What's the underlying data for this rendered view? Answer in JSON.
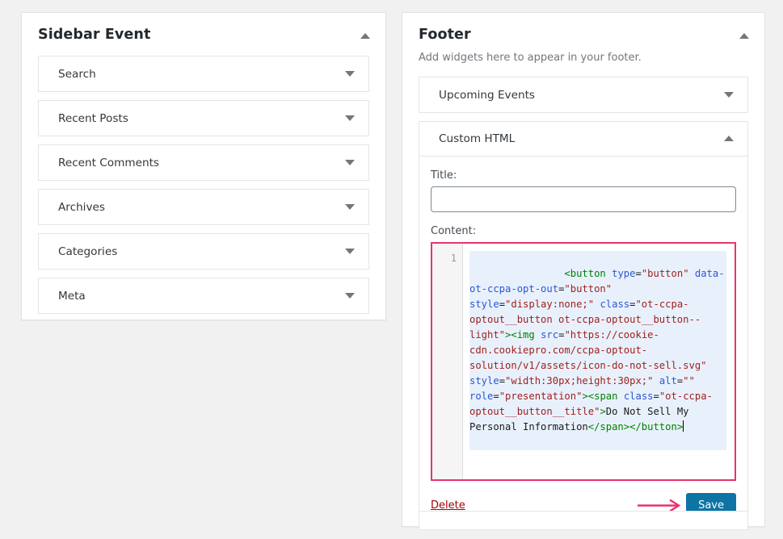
{
  "sidebar_panel": {
    "title": "Sidebar Event",
    "toggle_icon": "triangle-up-icon",
    "widgets": [
      {
        "label": "Search",
        "arrow_icon": "triangle-down-icon"
      },
      {
        "label": "Recent Posts",
        "arrow_icon": "triangle-down-icon"
      },
      {
        "label": "Recent Comments",
        "arrow_icon": "triangle-down-icon"
      },
      {
        "label": "Archives",
        "arrow_icon": "triangle-down-icon"
      },
      {
        "label": "Categories",
        "arrow_icon": "triangle-down-icon"
      },
      {
        "label": "Meta",
        "arrow_icon": "triangle-down-icon"
      }
    ]
  },
  "footer_panel": {
    "title": "Footer",
    "description": "Add widgets here to appear in your footer.",
    "toggle_icon": "triangle-up-icon",
    "widgets": [
      {
        "label": "Upcoming Events",
        "arrow_icon": "triangle-down-icon"
      },
      {
        "label": "Custom HTML",
        "arrow_icon": "triangle-up-icon"
      }
    ],
    "custom_html": {
      "title_label": "Title:",
      "title_value": "",
      "title_placeholder": "",
      "content_label": "Content:",
      "line_number": "1",
      "code_tokens": [
        {
          "t": "tag",
          "v": "<button"
        },
        {
          "t": "txt",
          "v": " "
        },
        {
          "t": "attr",
          "v": "type"
        },
        {
          "t": "txt",
          "v": "="
        },
        {
          "t": "str",
          "v": "\"button\""
        },
        {
          "t": "txt",
          "v": " "
        },
        {
          "t": "attr",
          "v": "data-ot-ccpa-opt-out"
        },
        {
          "t": "txt",
          "v": "="
        },
        {
          "t": "str",
          "v": "\"button\""
        },
        {
          "t": "txt",
          "v": " "
        },
        {
          "t": "attr",
          "v": "style"
        },
        {
          "t": "txt",
          "v": "="
        },
        {
          "t": "str",
          "v": "\"display:none;\""
        },
        {
          "t": "txt",
          "v": " "
        },
        {
          "t": "attr",
          "v": "class"
        },
        {
          "t": "txt",
          "v": "="
        },
        {
          "t": "str",
          "v": "\"ot-ccpa-optout__button ot-ccpa-optout__button--light\""
        },
        {
          "t": "tag",
          "v": ">"
        },
        {
          "t": "tag",
          "v": "<img"
        },
        {
          "t": "txt",
          "v": " "
        },
        {
          "t": "attr",
          "v": "src"
        },
        {
          "t": "txt",
          "v": "="
        },
        {
          "t": "str",
          "v": "\"https://cookie-cdn.cookiepro.com/ccpa-optout-solution/v1/assets/icon-do-not-sell.svg\""
        },
        {
          "t": "txt",
          "v": " "
        },
        {
          "t": "attr",
          "v": "style"
        },
        {
          "t": "txt",
          "v": "="
        },
        {
          "t": "str",
          "v": "\"width:30px;height:30px;\""
        },
        {
          "t": "txt",
          "v": " "
        },
        {
          "t": "attr",
          "v": "alt"
        },
        {
          "t": "txt",
          "v": "="
        },
        {
          "t": "str",
          "v": "\"\""
        },
        {
          "t": "txt",
          "v": " "
        },
        {
          "t": "attr",
          "v": "role"
        },
        {
          "t": "txt",
          "v": "="
        },
        {
          "t": "str",
          "v": "\"presentation\""
        },
        {
          "t": "tag",
          "v": ">"
        },
        {
          "t": "tag",
          "v": "<span"
        },
        {
          "t": "txt",
          "v": " "
        },
        {
          "t": "attr",
          "v": "class"
        },
        {
          "t": "txt",
          "v": "="
        },
        {
          "t": "str",
          "v": "\"ot-ccpa-optout__button__title\""
        },
        {
          "t": "tag",
          "v": ">"
        },
        {
          "t": "txt",
          "v": "Do Not Sell My Personal Information"
        },
        {
          "t": "tag",
          "v": "</span>"
        },
        {
          "t": "tag",
          "v": "</button>"
        }
      ],
      "code_plain": "<button type=\"button\" data-ot-ccpa-opt-out=\"button\" style=\"display:none;\" class=\"ot-ccpa-optout__button ot-ccpa-optout__button--light\"><img src=\"https://cookie-cdn.cookiepro.com/ccpa-optout-solution/v1/assets/icon-do-not-sell.svg\" style=\"width:30px;height:30px;\" alt=\"\" role=\"presentation\"><span class=\"ot-ccpa-optout__button__title\">Do Not Sell My Personal Information</span></button>",
      "delete_label": "Delete",
      "save_label": "Save"
    }
  },
  "colors": {
    "page_background": "#f1f1f1",
    "panel_background": "#ffffff",
    "panel_border": "#e2e2e2",
    "widget_border": "#e5e5e5",
    "annotation_red": "#e8336d",
    "save_button": "#0d74a4",
    "delete_link": "#aa0000",
    "code_tag": "#008000",
    "code_attr": "#2b55d6",
    "code_string": "#a11f1f",
    "code_text": "#1b1b1b",
    "active_line": "#e8f1fb",
    "gutter": "#f5f5f5"
  }
}
